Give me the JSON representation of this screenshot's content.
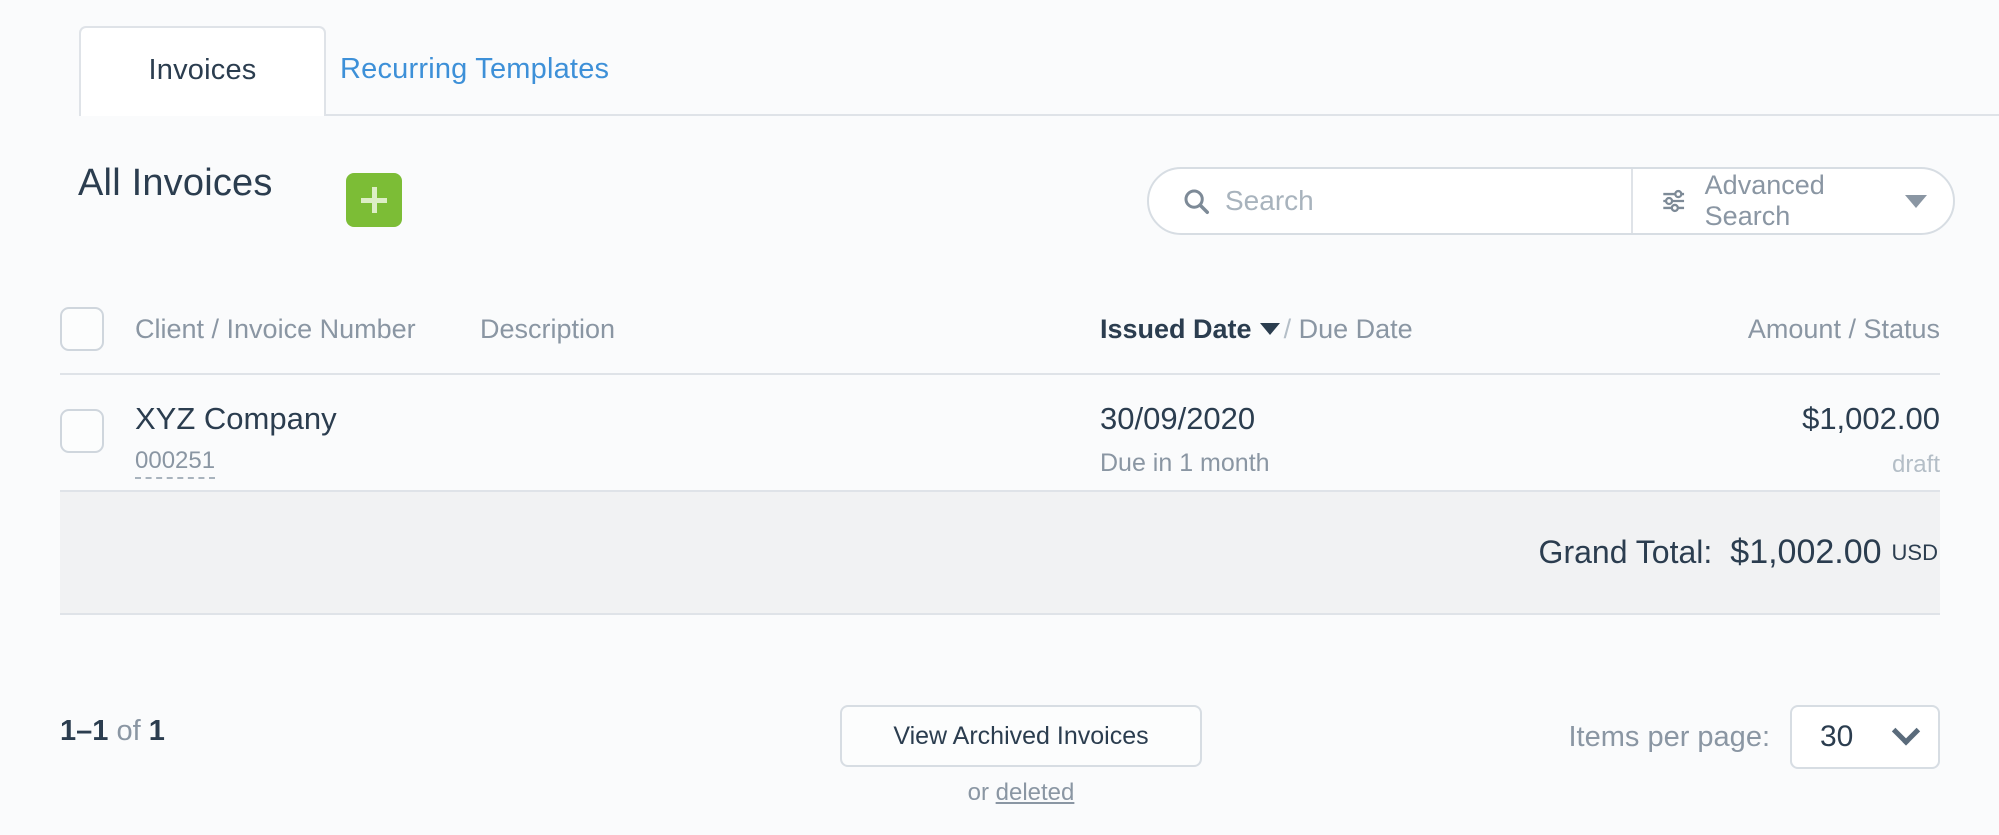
{
  "tabs": [
    {
      "label": "Invoices",
      "active": true
    },
    {
      "label": "Recurring Templates",
      "active": false
    }
  ],
  "header": {
    "title": "All Invoices",
    "add_button_icon": "plus-icon"
  },
  "search": {
    "placeholder": "Search",
    "value": "",
    "search_icon": "search-icon",
    "advanced_label": "Advanced Search",
    "filter_icon": "sliders-icon",
    "caret_icon": "caret-down-icon"
  },
  "table": {
    "columns": {
      "client": "Client / Invoice Number",
      "description": "Description",
      "issued_date": "Issued Date",
      "date_separator": "/",
      "due_date": "Due Date",
      "amount_status": "Amount / Status"
    },
    "sort": {
      "column": "Issued Date",
      "direction": "desc"
    },
    "rows": [
      {
        "client": "XYZ Company",
        "invoice_number": "000251",
        "description": "",
        "issued_date": "30/09/2020",
        "due_text": "Due in 1 month",
        "amount": "$1,002.00",
        "status": "draft"
      }
    ],
    "grand_total": {
      "label": "Grand Total:",
      "amount": "$1,002.00",
      "currency": "USD"
    }
  },
  "footer": {
    "range": "1–1",
    "of": "of",
    "total": "1",
    "archived_button": "View Archived Invoices",
    "or_text": "or",
    "deleted_link": "deleted",
    "items_per_page_label": "Items per page:",
    "items_per_page_value": "30"
  },
  "colors": {
    "accent_green": "#7cbd36",
    "link_blue": "#3d90d8",
    "text_dark": "#2b3d4f",
    "text_muted": "#8a96a3",
    "total_row_bg": "#f1f2f3",
    "page_bg": "#fafbfc"
  }
}
